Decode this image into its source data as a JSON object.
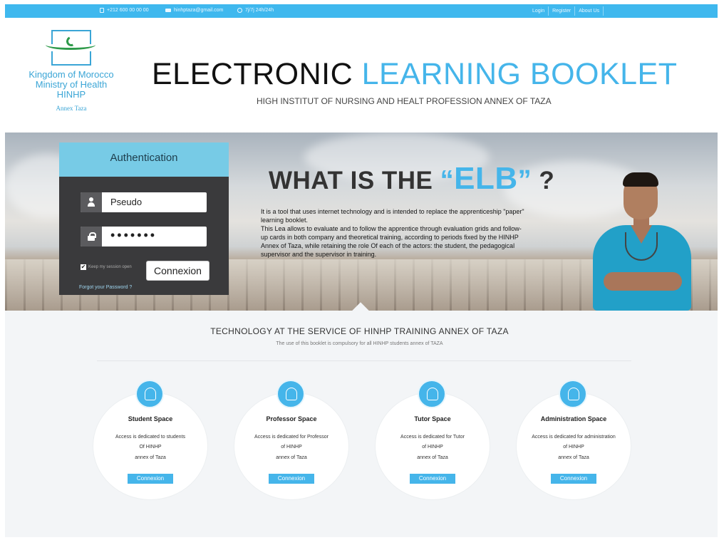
{
  "topbar": {
    "phone": "+212 600 00 00 00",
    "email": "hinhptaza@gmail.com",
    "hours": "7j/7j 24h/24h",
    "links": [
      "Login",
      "Register",
      "About Us"
    ]
  },
  "logo": {
    "line1": "Kingdom of Morocco",
    "line2": "Ministry of Health",
    "line3": "HINHP",
    "line4": "Annex Taza"
  },
  "header": {
    "title_part1": "ELECTRONIC ",
    "title_part2": "LEARNING BOOKLET",
    "subtitle": "HIGH INSTITUT OF NURSING AND HEALT PROFESSION ANNEX OF TAZA"
  },
  "auth": {
    "title": "Authentication",
    "username_value": "Pseudo",
    "password_dots": "•••••••",
    "keep_session": "Keep my session open",
    "keep_checked": "✔",
    "connect_label": "Connexion",
    "forgot_label": "Forgot your Password ?"
  },
  "hero": {
    "what_prefix": "WHAT IS THE ",
    "quote_open": "“",
    "elb": "ELB",
    "quote_close": "”",
    "question_mark": " ?",
    "description": "It is a tool that uses internet technology and is intended to replace the apprenticeship \"paper\" learning booklet.\nThis Lea allows to evaluate and to follow the apprentice through evaluation grids and follow-up cards in both company and theoretical training, according to periods fixed by the HINHP Annex of Taza, while retaining the role Of each of the actors: the student, the pedagogical supervisor and the supervisor in training."
  },
  "section": {
    "title": "TECHNOLOGY AT THE SERVICE OF HINHP TRAINING ANNEX OF TAZA",
    "subtitle": "The use of this booklet is compulsory for all HINHP students annex of TAZA"
  },
  "spaces": [
    {
      "icon": "graduate-icon",
      "title": "Student Space",
      "line1": "Access is dedicated to students",
      "line2": "Of HINHP",
      "line3": "annex of Taza",
      "button": "Connexion"
    },
    {
      "icon": "professor-icon",
      "title": "Professor Space",
      "line1": "Access is dedicated for Professor",
      "line2": "of HINHP",
      "line3": "annex of Taza",
      "button": "Connexion"
    },
    {
      "icon": "tutor-icon",
      "title": "Tutor Space",
      "line1": "Access is dedicated for Tutor",
      "line2": "of HINHP",
      "line3": "annex of Taza",
      "button": "Connexion"
    },
    {
      "icon": "administration-icon",
      "title": "Administration Space",
      "line1": "Access is dedicated for administration",
      "line2": "of HINHP",
      "line3": "annex of Taza",
      "button": "Connexion"
    }
  ],
  "colors": {
    "accent": "#45b5ea",
    "topbar": "#3fb8ee",
    "auth_header": "#77cbe6",
    "auth_panel": "#3a3a3c"
  }
}
